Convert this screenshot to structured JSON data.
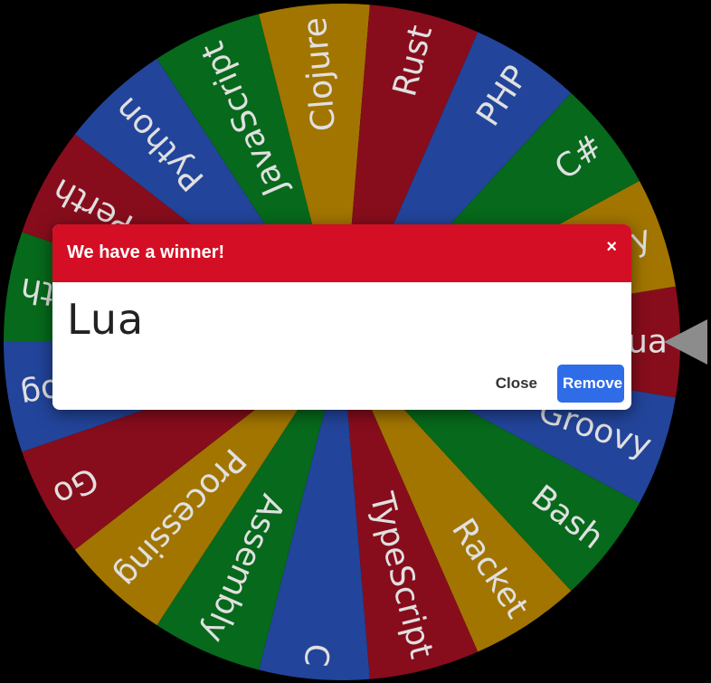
{
  "wheel": {
    "entries": [
      {
        "label": "Lua",
        "color": "#870d1c"
      },
      {
        "label": "Groovy",
        "color": "#22449a"
      },
      {
        "label": "Bash",
        "color": "#06691b"
      },
      {
        "label": "Racket",
        "color": "#a27501"
      },
      {
        "label": "TypeScript",
        "color": "#870d1c"
      },
      {
        "label": "C",
        "color": "#22449a"
      },
      {
        "label": "Assembly",
        "color": "#06691b"
      },
      {
        "label": "Processing",
        "color": "#a27501"
      },
      {
        "label": "Go",
        "color": "#870d1c"
      },
      {
        "label": "Dog",
        "color": "#22449a"
      },
      {
        "label": "Forth",
        "color": "#06691b"
      },
      {
        "label": "Perth",
        "color": "#870d1c"
      },
      {
        "label": "Python",
        "color": "#22449a"
      },
      {
        "label": "JavaScript",
        "color": "#06691b"
      },
      {
        "label": "Clojure",
        "color": "#a27501"
      },
      {
        "label": "Rust",
        "color": "#870d1c"
      },
      {
        "label": "PHP",
        "color": "#22449a"
      },
      {
        "label": "C#",
        "color": "#06691b"
      },
      {
        "label": "Ruby",
        "color": "#a27501"
      }
    ],
    "pointer_icon": "triangle-pointer-icon"
  },
  "modal": {
    "title": "We have a winner!",
    "close_glyph": "×",
    "winner": "Lua",
    "close_label": "Close",
    "remove_label": "Remove"
  }
}
